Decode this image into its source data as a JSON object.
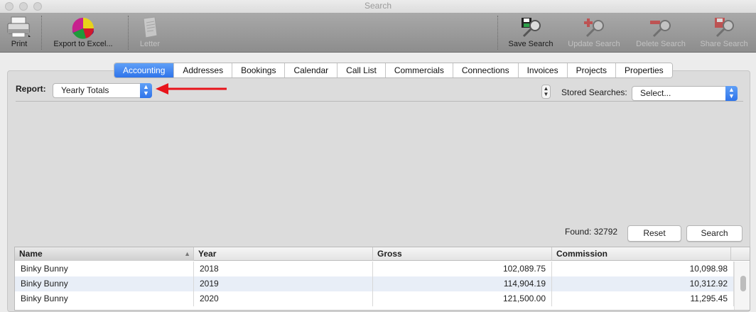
{
  "window": {
    "title": "Search"
  },
  "toolbar": {
    "left": [
      {
        "label": "Print",
        "icon": "printer-icon",
        "disabled": false
      },
      {
        "label": "Export to Excel...",
        "icon": "pie-chart-icon",
        "disabled": false
      },
      {
        "label": "Letter",
        "icon": "letter-icon",
        "disabled": true
      }
    ],
    "right": [
      {
        "label": "Save Search",
        "icon": "save-search-icon",
        "disabled": false
      },
      {
        "label": "Update Search",
        "icon": "update-search-icon",
        "disabled": true
      },
      {
        "label": "Delete Search",
        "icon": "delete-search-icon",
        "disabled": true
      },
      {
        "label": "Share Search",
        "icon": "share-search-icon",
        "disabled": true
      }
    ]
  },
  "tabs": [
    "Accounting",
    "Addresses",
    "Bookings",
    "Calendar",
    "Call List",
    "Commercials",
    "Connections",
    "Invoices",
    "Projects",
    "Properties"
  ],
  "active_tab": "Accounting",
  "report": {
    "label": "Report:",
    "value": "Yearly Totals"
  },
  "stored_searches": {
    "label": "Stored Searches:",
    "value": "Select..."
  },
  "found": "Found: 32792",
  "buttons": {
    "reset": "Reset",
    "search": "Search"
  },
  "table": {
    "columns": [
      "Name",
      "Year",
      "Gross",
      "Commission"
    ],
    "sorted_column": "Name",
    "rows": [
      [
        "Binky Bunny",
        "2018",
        "102,089.75",
        "10,098.98"
      ],
      [
        "Binky Bunny",
        "2019",
        "114,904.19",
        "10,312.92"
      ],
      [
        "Binky Bunny",
        "2020",
        "121,500.00",
        "11,295.45"
      ]
    ]
  },
  "colors": {
    "accent": "#2f74ea",
    "annotation_arrow": "#e8141b",
    "selected_row": "#e8eef7"
  }
}
